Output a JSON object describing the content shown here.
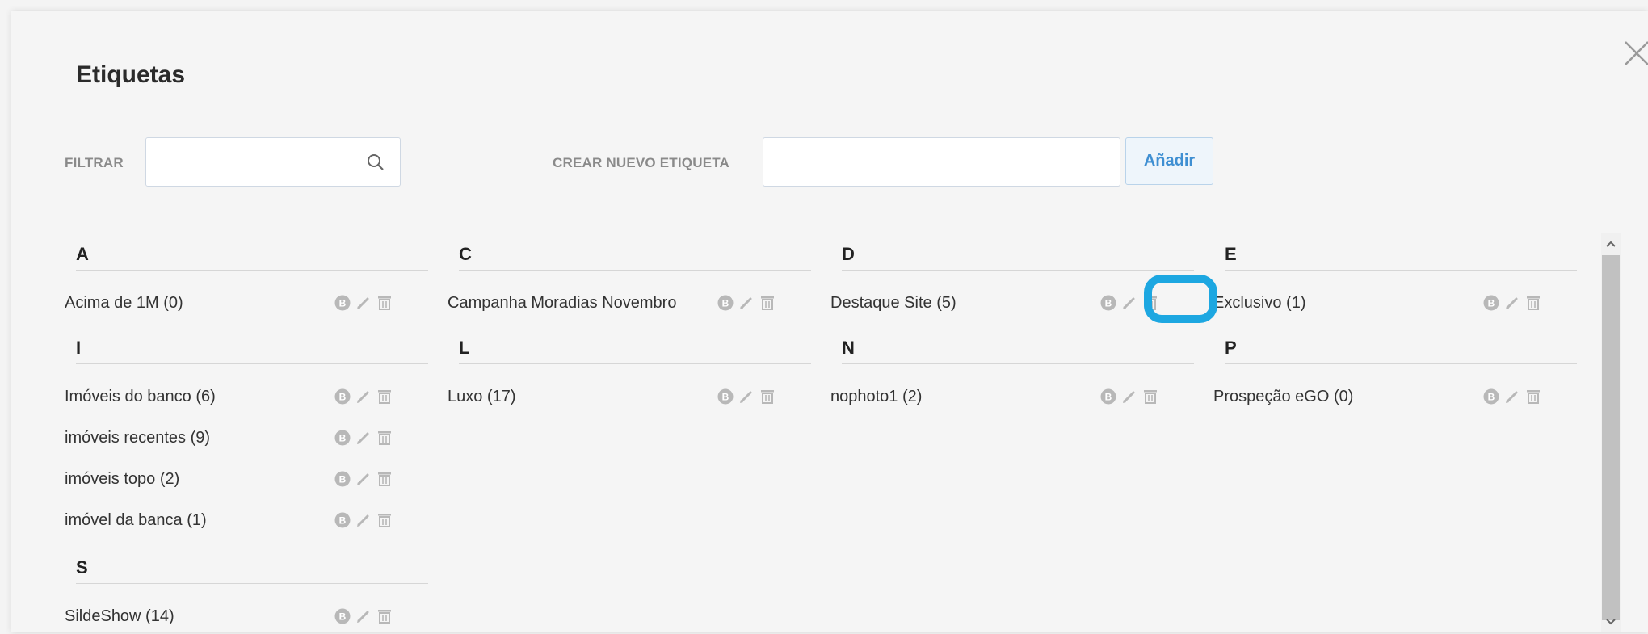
{
  "modal": {
    "title": "Etiquetas",
    "close_icon": "close-icon"
  },
  "filter": {
    "label": "FILTRAR",
    "value": "",
    "placeholder": "",
    "icon": "search-icon"
  },
  "create": {
    "label": "CREAR NUEVO ETIQUETA",
    "value": "",
    "placeholder": "",
    "button_label": "Añadir"
  },
  "groups": [
    {
      "letter": "A",
      "tags": [
        "Acima de 1M (0)"
      ]
    },
    {
      "letter": "C",
      "tags": [
        "Campanha Moradias Novembro"
      ]
    },
    {
      "letter": "D",
      "tags": [
        "Destaque Site (5)"
      ]
    },
    {
      "letter": "E",
      "tags": [
        "Exclusivo (1)"
      ]
    },
    {
      "letter": "I",
      "tags": [
        "Imóveis do banco (6)",
        "imóveis recentes (9)",
        "imóveis topo (2)",
        "imóvel da banca (1)"
      ]
    },
    {
      "letter": "L",
      "tags": [
        "Luxo (17)"
      ]
    },
    {
      "letter": "N",
      "tags": [
        "nophoto1 (2)"
      ]
    },
    {
      "letter": "P",
      "tags": [
        "Prospeção eGO (0)"
      ]
    },
    {
      "letter": "S",
      "tags": [
        "SildeShow (14)"
      ]
    }
  ],
  "tag_action_icons": [
    "b-badge-icon",
    "pencil-icon",
    "trash-icon"
  ],
  "highlight": {
    "color": "#1da7e1",
    "target": "trash-icon"
  },
  "colors": {
    "accent": "#3f8fd2",
    "highlight": "#1da7e1",
    "text": "#333333",
    "icon": "#b3b3b3"
  }
}
